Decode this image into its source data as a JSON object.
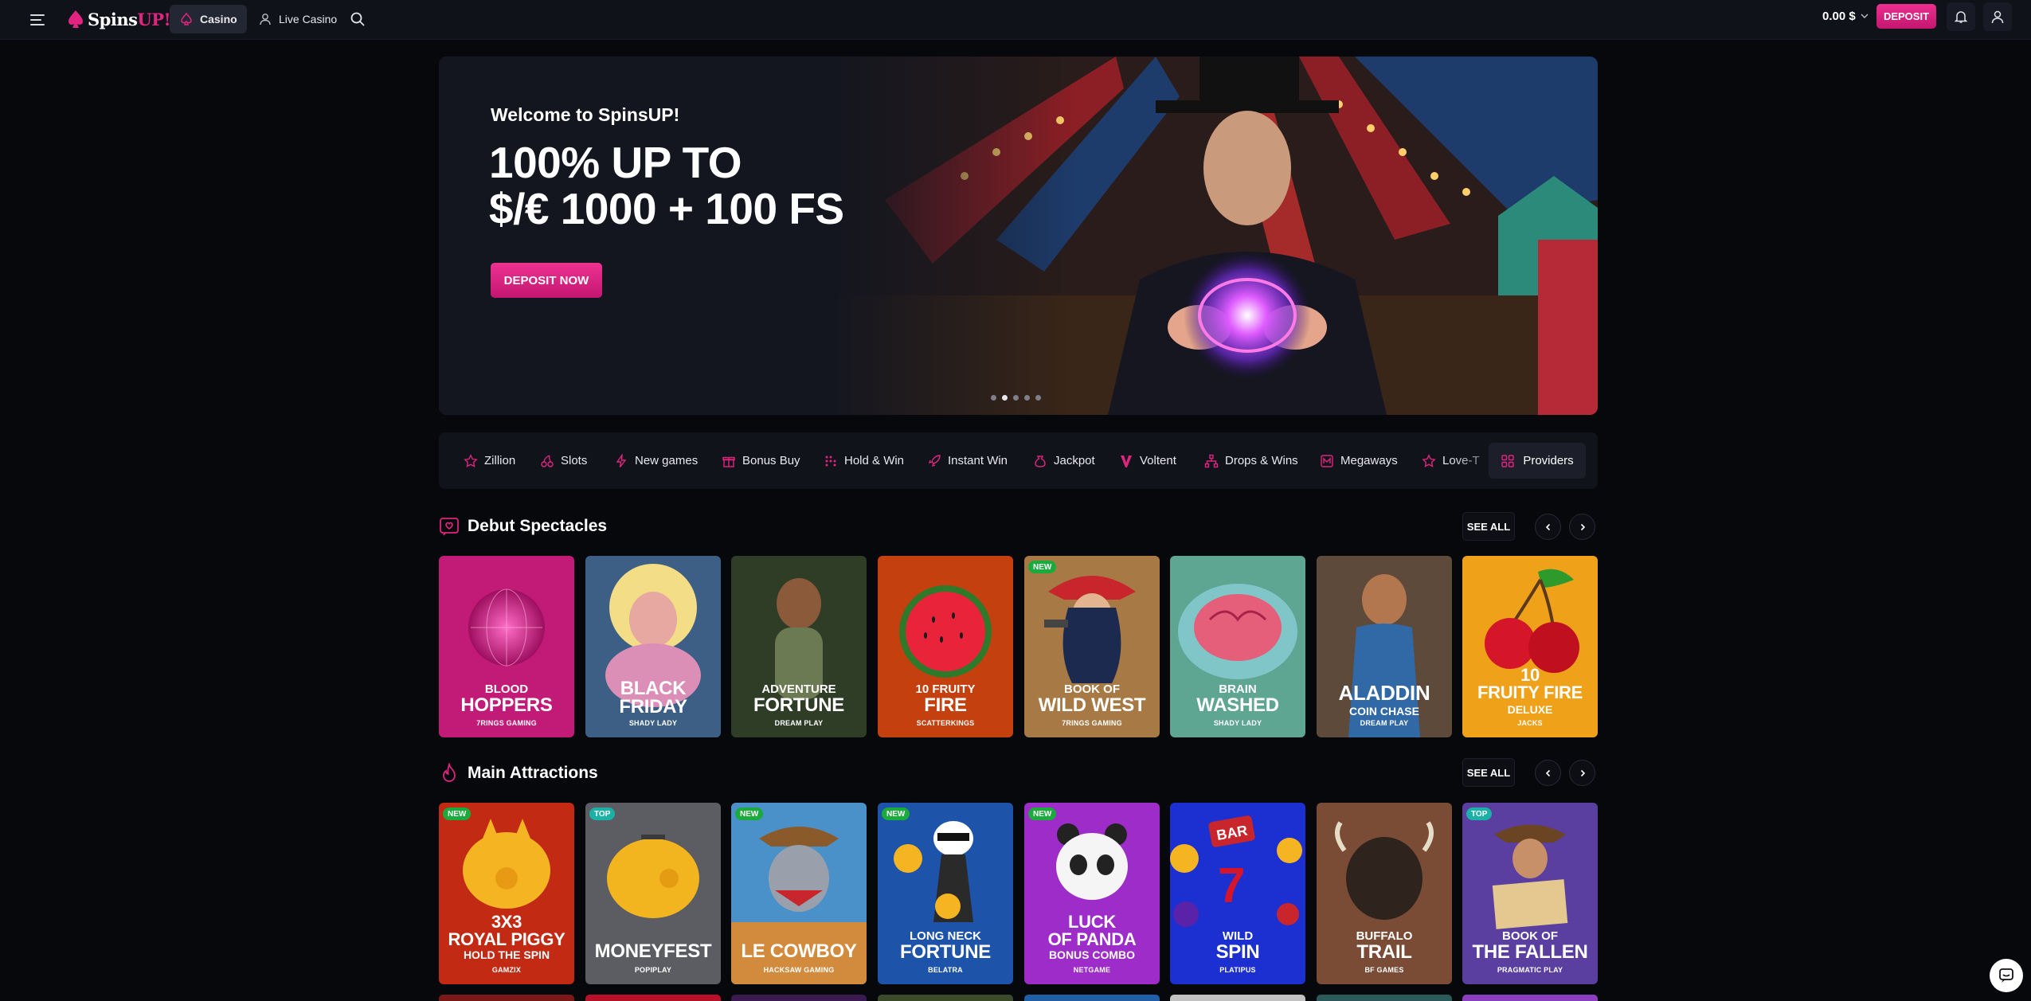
{
  "header": {
    "logo": {
      "prefix": "Spins",
      "suffix": "UP!"
    },
    "tabs": [
      {
        "label": "Casino",
        "icon": "spade-icon"
      },
      {
        "label": "Live Casino",
        "icon": "dealer-icon"
      }
    ],
    "balance": "0.00 $",
    "deposit_label": "DEPOSIT"
  },
  "hero": {
    "welcome": "Welcome to SpinsUP!",
    "title_line1": "100% UP TO",
    "title_line2": "$/€ 1000 + 100 FS",
    "button": "DEPOSIT NOW",
    "slides_total": 5,
    "active_slide": 2
  },
  "categories": [
    {
      "label": "Zillion",
      "icon": "star-icon"
    },
    {
      "label": "Slots",
      "icon": "cherries-icon"
    },
    {
      "label": "New games",
      "icon": "lightning-icon"
    },
    {
      "label": "Bonus Buy",
      "icon": "gift-icon"
    },
    {
      "label": "Hold & Win",
      "icon": "grid-dots-icon"
    },
    {
      "label": "Instant Win",
      "icon": "rocket-icon"
    },
    {
      "label": "Jackpot",
      "icon": "money-bag-icon"
    },
    {
      "label": "Voltent",
      "icon": "voltent-logo-icon"
    },
    {
      "label": "Drops & Wins",
      "icon": "network-icon"
    },
    {
      "label": "Megaways",
      "icon": "megaways-icon"
    },
    {
      "label": "Love-T",
      "icon": "star-outline-icon"
    }
  ],
  "providers_label": "Providers",
  "sections": [
    {
      "title": "Debut Spectacles",
      "see_all": "SEE ALL",
      "games": [
        {
          "line1": "BLOOD",
          "line2": "HOPPERS",
          "line3": "",
          "provider": "7RINGS GAMING",
          "badge": ""
        },
        {
          "line1": "",
          "line2": "BLACK FRIDAY",
          "line3": "",
          "provider": "SHADY LADY",
          "badge": ""
        },
        {
          "line1": "ADVENTURE",
          "line2": "FORTUNE",
          "line3": "",
          "provider": "DREAM PLAY",
          "badge": ""
        },
        {
          "line1": "10 FRUITY",
          "line2": "FIRE",
          "line3": "",
          "provider": "SCATTERKINGS",
          "badge": ""
        },
        {
          "line1": "BOOK OF",
          "line2": "WILD WEST",
          "line3": "",
          "provider": "7RINGS GAMING",
          "badge": "NEW"
        },
        {
          "line1": "BRAIN",
          "line2": "WASHED",
          "line3": "",
          "provider": "SHADY LADY",
          "badge": ""
        },
        {
          "line1": "",
          "line2": "ALADDIN",
          "line3": "COIN CHASE",
          "provider": "DREAM PLAY",
          "badge": ""
        },
        {
          "line1": "10",
          "line2": "FRUITY FIRE",
          "line3": "DELUXE",
          "provider": "JACKS",
          "badge": ""
        }
      ]
    },
    {
      "title": "Main Attractions",
      "see_all": "SEE ALL",
      "games": [
        {
          "line1": "3X3",
          "line2": "ROYAL PIGGY",
          "line3": "HOLD THE SPIN",
          "provider": "GAMZIX",
          "badge": "NEW"
        },
        {
          "line1": "",
          "line2": "MONEYFEST",
          "line3": "",
          "provider": "POPIPLAY",
          "badge": "TOP"
        },
        {
          "line1": "",
          "line2": "LE COWBOY",
          "line3": "",
          "provider": "HACKSAW GAMING",
          "badge": "NEW"
        },
        {
          "line1": "LONG NECK",
          "line2": "FORTUNE",
          "line3": "",
          "provider": "BELATRA",
          "badge": "NEW"
        },
        {
          "line1": "LUCK",
          "line2": "OF PANDA",
          "line3": "BONUS COMBO",
          "provider": "NETGAME",
          "badge": "NEW"
        },
        {
          "line1": "WILD",
          "line2": "SPIN",
          "line3": "",
          "provider": "PLATIPUS",
          "badge": ""
        },
        {
          "line1": "BUFFALO",
          "line2": "TRAIL",
          "line3": "",
          "provider": "BF GAMES",
          "badge": ""
        },
        {
          "line1": "BOOK OF",
          "line2": "THE FALLEN",
          "line3": "",
          "provider": "PRAGMATIC PLAY",
          "badge": "TOP"
        }
      ]
    }
  ]
}
